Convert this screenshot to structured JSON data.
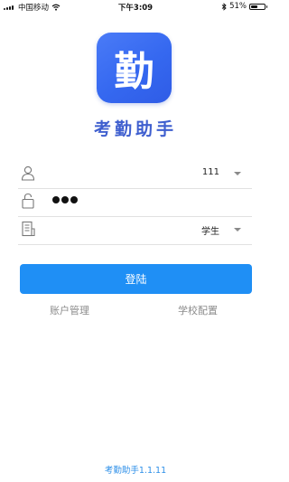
{
  "status_bar": {
    "carrier": "中国移动",
    "time": "下午3:09",
    "battery_percent": "51%",
    "battery_level": 0.51,
    "icons": [
      "signal-icon",
      "wifi-icon",
      "bluetooth-icon",
      "battery-icon"
    ]
  },
  "app": {
    "logo_char": "勤",
    "name": "考勤助手",
    "version_text": "考勤助手1.1.11",
    "accent": "#1f8ff5",
    "logo_color": "#3568f0"
  },
  "form": {
    "account": {
      "icon": "user-icon",
      "value": "111"
    },
    "password": {
      "icon": "lock-icon",
      "masked_length": 3
    },
    "role": {
      "icon": "document-icon",
      "value": "学生"
    }
  },
  "buttons": {
    "login_label": "登陆",
    "account_manage_label": "账户管理",
    "school_config_label": "学校配置"
  }
}
